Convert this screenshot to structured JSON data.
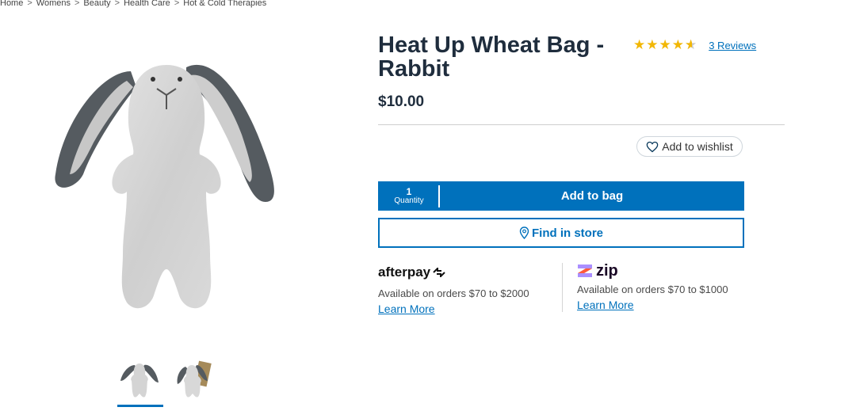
{
  "breadcrumb": {
    "items": [
      "Home",
      "Womens",
      "Beauty",
      "Health Care",
      "Hot & Cold Therapies"
    ],
    "separator": ">"
  },
  "product": {
    "title": "Heat Up Wheat Bag - Rabbit",
    "price": "$10.00",
    "rating": {
      "stars": 4.5,
      "max": 5,
      "reviews_label": "3 Reviews"
    }
  },
  "wishlist": {
    "label": "Add to wishlist",
    "icon": "heart-outline-icon"
  },
  "cart": {
    "quantity_value": "1",
    "quantity_label": "Quantity",
    "add_label": "Add to bag",
    "color": "#0071bc"
  },
  "store": {
    "label": "Find in store",
    "icon": "location-pin-icon"
  },
  "payments": {
    "afterpay": {
      "logo": "afterpay",
      "text": "Available on orders $70 to $2000",
      "link": "Learn More"
    },
    "zip": {
      "logo": "zip",
      "text": "Available on orders $70 to $1000",
      "link": "Learn More"
    }
  },
  "gallery": {
    "thumbnails": 2,
    "selected": 1
  }
}
